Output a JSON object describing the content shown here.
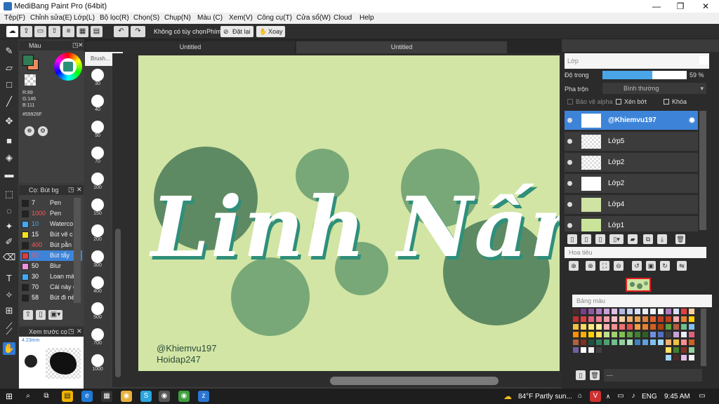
{
  "window": {
    "title": "MediBang Paint Pro (64bit)",
    "min": "—",
    "max": "❐",
    "close": "✕"
  },
  "menu": [
    "Tệp(F)",
    "Chỉnh sửa(E)",
    "Lớp(L)",
    "Bộ lọc(R)",
    "Chọn(S)",
    "Chụp(N)",
    "Màu (C)",
    "Xem(V)",
    "Công cụ(T)",
    "Cửa sổ(W)",
    "Cloud",
    "Help"
  ],
  "toolbar": {
    "option": "Không có tùy chọn",
    "key_label": "Phím",
    "reset": "Đặt lại",
    "rotate": "Xoay"
  },
  "tabs": [
    "Untitled",
    "Untitled"
  ],
  "color_panel": {
    "title": "Màu",
    "r": "R:89",
    "g": "G:146",
    "b": "B:111",
    "hex": "#59926F",
    "fg": "#2f7d55",
    "bg": "#f08a5d"
  },
  "brush_panel": {
    "title": "Cọ: Bút bg",
    "items": [
      {
        "size": "7",
        "name": "Pen",
        "color": "#222222",
        "size_color": "#ffffff"
      },
      {
        "size": "1000",
        "name": "Pen",
        "color": "#222222",
        "size_color": "#ff5555"
      },
      {
        "size": "10",
        "name": "Waterco",
        "color": "#3fa9f5",
        "size_color": "#3fa9f5"
      },
      {
        "size": "15",
        "name": "Bút vẽ c",
        "color": "#f2e21b",
        "size_color": "#ffffff"
      },
      {
        "size": "400",
        "name": "Bút pằn",
        "color": "#222222",
        "size_color": "#ff5555"
      },
      {
        "size": "50",
        "name": "Bút tẩy",
        "color": "#e43b3b",
        "size_color": "#ff5555"
      },
      {
        "size": "50",
        "name": "Blur",
        "color": "#f08ee0",
        "size_color": "#ffffff"
      },
      {
        "size": "30",
        "name": "Loan mà",
        "color": "#3fa9f5",
        "size_color": "#ffffff"
      },
      {
        "size": "70",
        "name": "Cái này c",
        "color": "#222222",
        "size_color": "#ffffff"
      },
      {
        "size": "58",
        "name": "Bút đi nè",
        "color": "#222222",
        "size_color": "#ffffff"
      }
    ]
  },
  "preview_panel": {
    "title": "Xem trước cọ",
    "size": "4.23mm"
  },
  "brush_sizes": {
    "header": "Brush...",
    "items": [
      "30",
      "40",
      "50",
      "70",
      "100",
      "150",
      "200",
      "300",
      "400",
      "500",
      "700",
      "1000"
    ]
  },
  "canvas": {
    "title_text": "Linh Nấm",
    "watermark_line1": "@Khiemvu197",
    "watermark_line2": "Hoidap247"
  },
  "layer_panel": {
    "title": "Lớp",
    "opacity_label": "Độ trong",
    "opacity_value": "59 %",
    "opacity_fraction": 0.59,
    "blend_label": "Pha trộn",
    "blend_value": "Bình thường",
    "protect_alpha": "Bảo vệ alpha",
    "clipping": "Xén bớt",
    "lock": "Khóa",
    "layers": [
      "@Khiemvu197",
      "Lớp5",
      "Lớp2",
      "Lớp2",
      "Lớp4",
      "Lớp1"
    ]
  },
  "navigator": {
    "title": "Hoa tiêu"
  },
  "palette": {
    "title": "Bảng màu",
    "footer": "---"
  },
  "taskbar": {
    "weather": "84°F  Partly sun...",
    "lang": "ENG",
    "time": "9:45 AM"
  }
}
